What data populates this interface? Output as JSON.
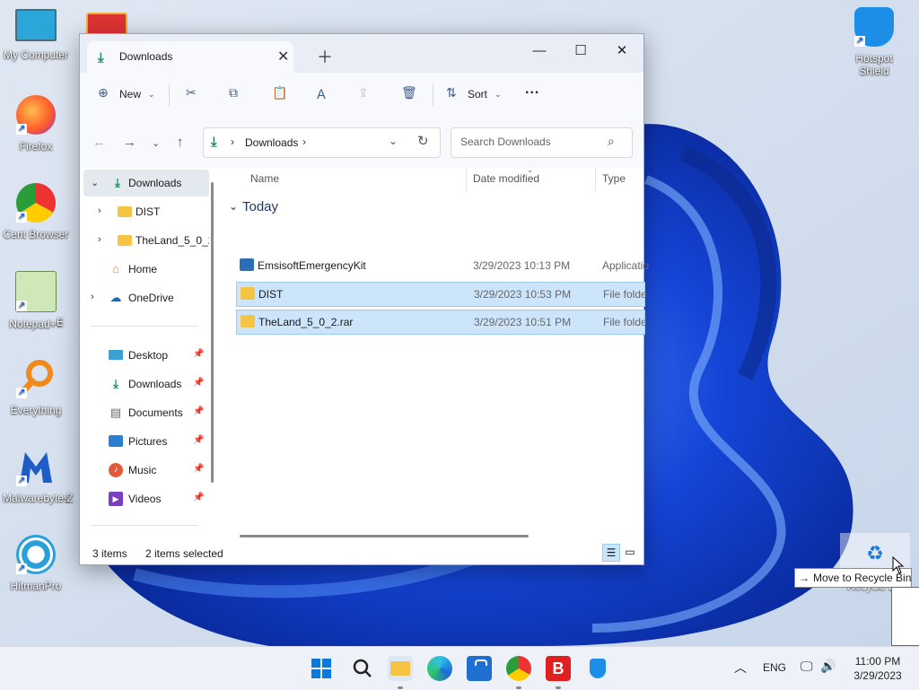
{
  "desktop": {
    "icons": [
      {
        "label": "My Computer",
        "name": "my-computer"
      },
      {
        "label": "Firefox",
        "name": "firefox"
      },
      {
        "label": "Cent Browser",
        "name": "cent-browser"
      },
      {
        "label": "Notepad++",
        "name": "notepad-plus-plus"
      },
      {
        "label": "Everything",
        "name": "everything"
      },
      {
        "label": "Malwarebytes",
        "name": "malwarebytes"
      },
      {
        "label": "HitmanPro",
        "name": "hitmanpro"
      },
      {
        "label": "Hotspot Shield",
        "name": "hotspot-shield"
      }
    ],
    "partial_labels": [
      "E",
      "Z"
    ]
  },
  "window": {
    "tab_title": "Downloads",
    "toolbar": {
      "new_label": "New",
      "sort_label": "Sort",
      "more_label": "..."
    },
    "address": {
      "segment": "Downloads",
      "search_placeholder": "Search Downloads"
    },
    "nav_pane": {
      "tree": [
        {
          "label": "Downloads",
          "selected": true
        },
        {
          "label": "DIST"
        },
        {
          "label": "TheLand_5_0_2"
        },
        {
          "label": "Home"
        },
        {
          "label": "OneDrive"
        }
      ],
      "quick_access": [
        {
          "label": "Desktop"
        },
        {
          "label": "Downloads"
        },
        {
          "label": "Documents"
        },
        {
          "label": "Pictures"
        },
        {
          "label": "Music"
        },
        {
          "label": "Videos"
        }
      ]
    },
    "columns": {
      "name": "Name",
      "date": "Date modified",
      "type": "Type"
    },
    "group_label": "Today",
    "files": [
      {
        "name": "EmsisoftEmergencyKit",
        "date": "3/29/2023 10:13 PM",
        "type": "Applicatio",
        "selected": false
      },
      {
        "name": "DIST",
        "date": "3/29/2023 10:53 PM",
        "type": "File folde",
        "selected": true
      },
      {
        "name": "TheLand_5_0_2.rar",
        "date": "3/29/2023 10:51 PM",
        "type": "File folde",
        "selected": true
      }
    ],
    "status": {
      "items": "3 items",
      "selected": "2 items selected"
    }
  },
  "drag": {
    "tooltip": "Move to Recycle Bin",
    "recycle_label": "Recycle Bin"
  },
  "taskbar": {
    "lang": "ENG",
    "time": "11:00 PM",
    "date": "3/29/2023"
  },
  "colors": {
    "accent": "#0067c0",
    "selection": "#cce5fb",
    "wallpaper": "#1d4fd8"
  }
}
